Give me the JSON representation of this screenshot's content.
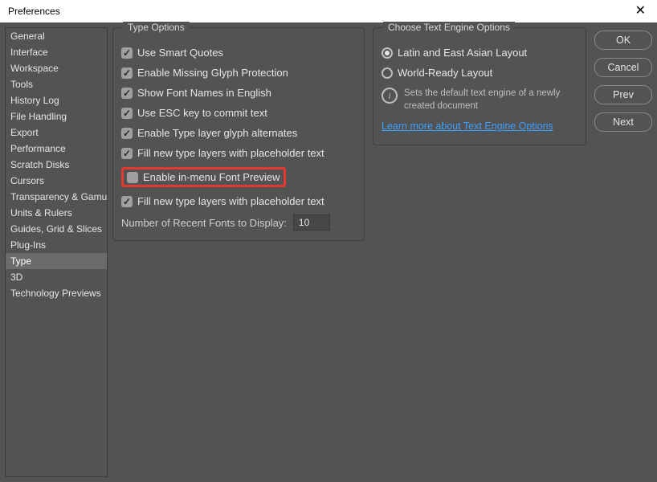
{
  "window": {
    "title": "Preferences"
  },
  "sidebar": {
    "items": [
      {
        "label": "General"
      },
      {
        "label": "Interface"
      },
      {
        "label": "Workspace"
      },
      {
        "label": "Tools"
      },
      {
        "label": "History Log"
      },
      {
        "label": "File Handling"
      },
      {
        "label": "Export"
      },
      {
        "label": "Performance"
      },
      {
        "label": "Scratch Disks"
      },
      {
        "label": "Cursors"
      },
      {
        "label": "Transparency & Gamut"
      },
      {
        "label": "Units & Rulers"
      },
      {
        "label": "Guides, Grid & Slices"
      },
      {
        "label": "Plug-Ins"
      },
      {
        "label": "Type"
      },
      {
        "label": "3D"
      },
      {
        "label": "Technology Previews"
      }
    ],
    "selected_index": 14
  },
  "type_options": {
    "legend": "Type Options",
    "items": [
      {
        "label": "Use Smart Quotes",
        "checked": true
      },
      {
        "label": "Enable Missing Glyph Protection",
        "checked": true
      },
      {
        "label": "Show Font Names in English",
        "checked": true
      },
      {
        "label": "Use ESC key to commit text",
        "checked": true
      },
      {
        "label": "Enable Type layer glyph alternates",
        "checked": true
      },
      {
        "label": "Fill new type layers with placeholder text",
        "checked": true
      },
      {
        "label": "Enable in-menu Font Preview",
        "checked": false
      },
      {
        "label": "Fill new type layers with placeholder text",
        "checked": true
      }
    ],
    "highlight_index": 6,
    "recent_fonts_label": "Number of Recent Fonts to Display:",
    "recent_fonts_value": "10"
  },
  "text_engine": {
    "legend": "Choose Text Engine Options",
    "options": [
      {
        "label": "Latin and East Asian Layout",
        "selected": true
      },
      {
        "label": "World-Ready Layout",
        "selected": false
      }
    ],
    "info_text": "Sets the default text engine of a newly created document",
    "link_text": "Learn more about Text Engine Options"
  },
  "buttons": {
    "ok": "OK",
    "cancel": "Cancel",
    "prev": "Prev",
    "next": "Next"
  }
}
